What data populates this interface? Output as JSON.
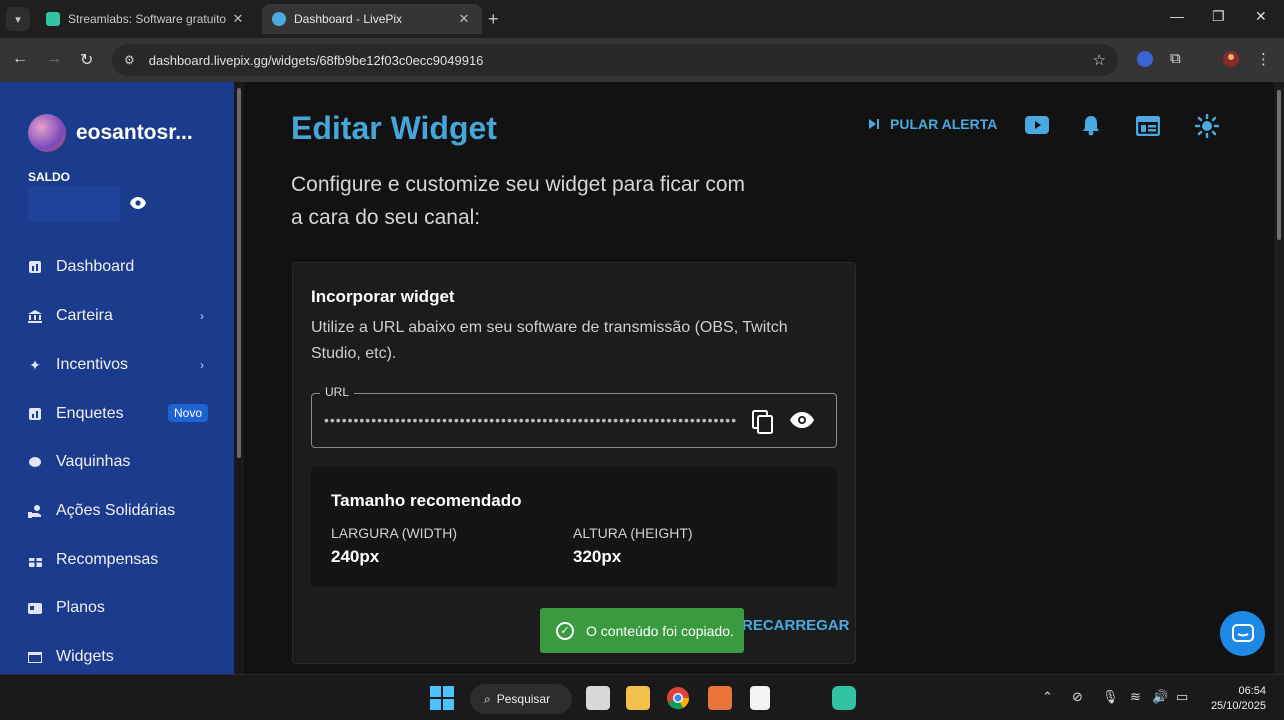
{
  "browser": {
    "tabs": [
      {
        "title": "Streamlabs: Software gratuito d",
        "active": false,
        "favicon_color": "#31c3a2"
      },
      {
        "title": "Dashboard - LivePix",
        "active": true,
        "favicon_color": "#4aa9e0"
      }
    ],
    "url": "dashboard.livepix.gg/widgets/68fb9be12f03c0ecc9049916"
  },
  "sidebar": {
    "username": "eosantosr...",
    "saldo_label": "SALDO",
    "items": [
      {
        "label": "Dashboard",
        "icon": "chart-icon",
        "chevron": false
      },
      {
        "label": "Carteira",
        "icon": "bank-icon",
        "chevron": true
      },
      {
        "label": "Incentivos",
        "icon": "sparkle-icon",
        "chevron": true
      },
      {
        "label": "Enquetes",
        "icon": "poll-icon",
        "chevron": false,
        "badge": "Novo"
      },
      {
        "label": "Vaquinhas",
        "icon": "piggy-icon",
        "chevron": false
      },
      {
        "label": "Ações Solidárias",
        "icon": "charity-icon",
        "chevron": false
      },
      {
        "label": "Recompensas",
        "icon": "gift-icon",
        "chevron": false
      },
      {
        "label": "Planos",
        "icon": "card-icon",
        "chevron": false
      },
      {
        "label": "Widgets",
        "icon": "widget-icon",
        "chevron": false
      }
    ]
  },
  "header": {
    "title": "Editar Widget",
    "subtitle": "Configure e customize seu widget para ficar com a cara do seu canal:",
    "skip_alert": "PULAR ALERTA"
  },
  "card": {
    "title": "Incorporar widget",
    "description": "Utilize a URL abaixo em seu software de transmissão (OBS, Twitch Studio, etc).",
    "url_legend": "URL",
    "url_masked": "••••••••••••••••••••••••••••••••••••••••••••••••••••••••••••••••••••••••••••••••",
    "recommended_title": "Tamanho recomendado",
    "width_label": "LARGURA (WIDTH)",
    "width_value": "240px",
    "height_label": "ALTURA (HEIGHT)",
    "height_value": "320px",
    "reload_label": "RECARREGAR"
  },
  "toast": {
    "message": "O conteúdo foi copiado."
  },
  "taskbar": {
    "search_label": "Pesquisar",
    "time": "06:54",
    "date": "25/10/2025"
  },
  "colors": {
    "accent": "#46a6d8",
    "sidebar": "#1b3c8c",
    "toast": "#3a9a3f"
  }
}
